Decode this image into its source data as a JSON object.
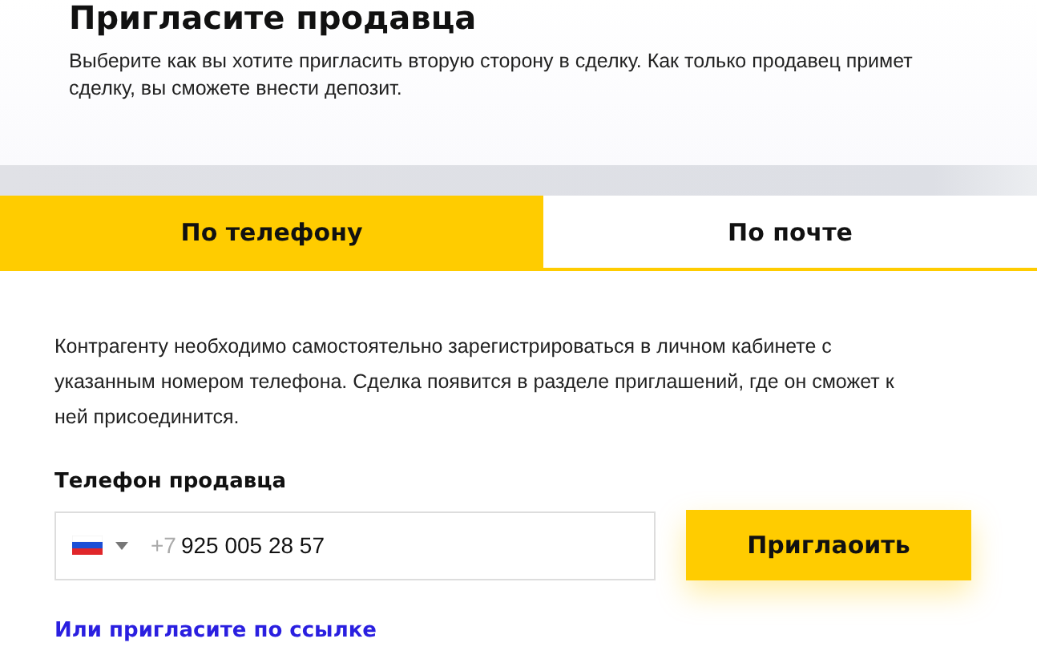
{
  "header": {
    "title": "Пригласите продавца",
    "description": "Выберите как вы хотите пригласить вторую сторону в сделку. Как только продавец примет сделку, вы сможете внести депозит."
  },
  "tabs": [
    {
      "label": "По телефону",
      "selected": true
    },
    {
      "label": "По почте",
      "selected": false
    }
  ],
  "info": "Контрагенту необходимо самостоятельно зарегистрироваться в личном кабинете с указанным номером телефона. Сделка появится в разделе приглашений, где он сможет к ней присоединится.",
  "phone_field": {
    "label": "Телефон продавца",
    "prefix": "+7",
    "value": "925 005 28 57"
  },
  "invite_button": "Приглаоить",
  "link": "Или пригласите по ссылке"
}
